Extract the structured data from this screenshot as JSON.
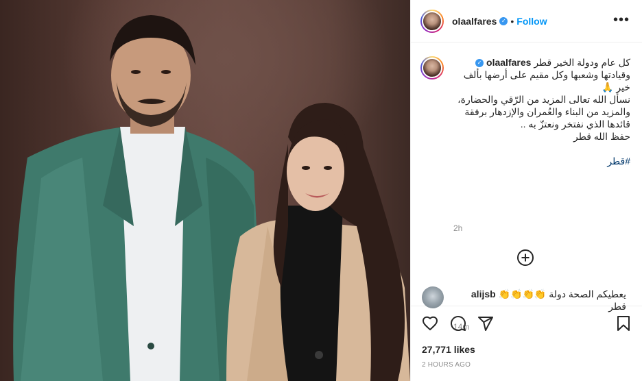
{
  "post": {
    "username": "olaalfares",
    "verified_mark": "✓",
    "separator": "•",
    "follow_label": "Follow",
    "more_label": "•••",
    "caption_lines": [
      "كل عام ودولة الخير قطر",
      "وقيادتها وشعبها وكل مقيم على أرضها بألف",
      "خير 🙏",
      "نسأل الله تعالى المزيد من الرّقي والحضارة،",
      "والمزيد من البناء والعُمران والإزدهار برفقة",
      "قائدها الذي نفتخر ونعتزّ به ..",
      "حفظ الله قطر"
    ],
    "hashtag": "#قطر",
    "caption_time": "2h",
    "likes": "27,771 likes",
    "posted_ago": "2 HOURS AGO"
  },
  "comment": {
    "username": "alijsb",
    "text_line1": "يعطيكم الصحة دولة 👏👏👏👏",
    "text_line2": "قطر",
    "time": "14m"
  },
  "icons": {
    "like": "heart-icon",
    "comment": "comment-icon",
    "share": "share-icon",
    "save": "bookmark-icon",
    "add": "plus-circle-icon",
    "more": "more-options-icon"
  },
  "colors": {
    "follow": "#0095f6",
    "verified": "#3897f0",
    "hashtag": "#00376b",
    "muted": "#8e8e8e"
  }
}
